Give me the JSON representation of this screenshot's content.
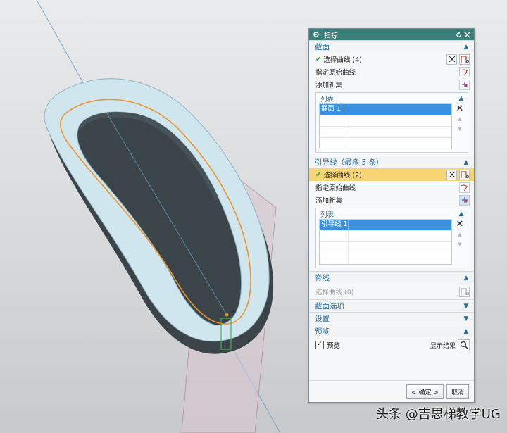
{
  "dialog": {
    "title": "扫掠",
    "section_profile": {
      "label": "截面",
      "select_curve": "选择曲线 (4)",
      "specify_origin": "指定原始曲线",
      "add_new_set": "添加新集",
      "list": {
        "label": "列表",
        "items": [
          "截面 1"
        ]
      }
    },
    "section_guide": {
      "label": "引导线（最多 3 条）",
      "select_curve": "选择曲线 (2)",
      "specify_origin": "指定原始曲线",
      "add_new_set": "添加新集",
      "list": {
        "label": "列表",
        "items": [
          "引导线 1"
        ]
      }
    },
    "section_spine": {
      "label": "脊线",
      "select_curve": "选择曲线 (0)"
    },
    "section_options": {
      "label": "截面选项"
    },
    "section_settings": {
      "label": "设置"
    },
    "section_preview": {
      "label": "预览",
      "preview_checkbox": "预览",
      "preview_checked": true,
      "show_result": "显示结果"
    },
    "ok_button": "< 确定 >",
    "cancel_button": "取消"
  },
  "watermark": "头条 @吉思梯教学UG",
  "colors": {
    "titlebar": "#3b7f7a",
    "section_text": "#2a6f9c",
    "highlight_row": "#f7d574",
    "list_selection": "#3b91e0",
    "solid_face": "#cfe6ee",
    "guide_curve": "#f0932b",
    "sweep_plane": "#d9c6cf"
  }
}
